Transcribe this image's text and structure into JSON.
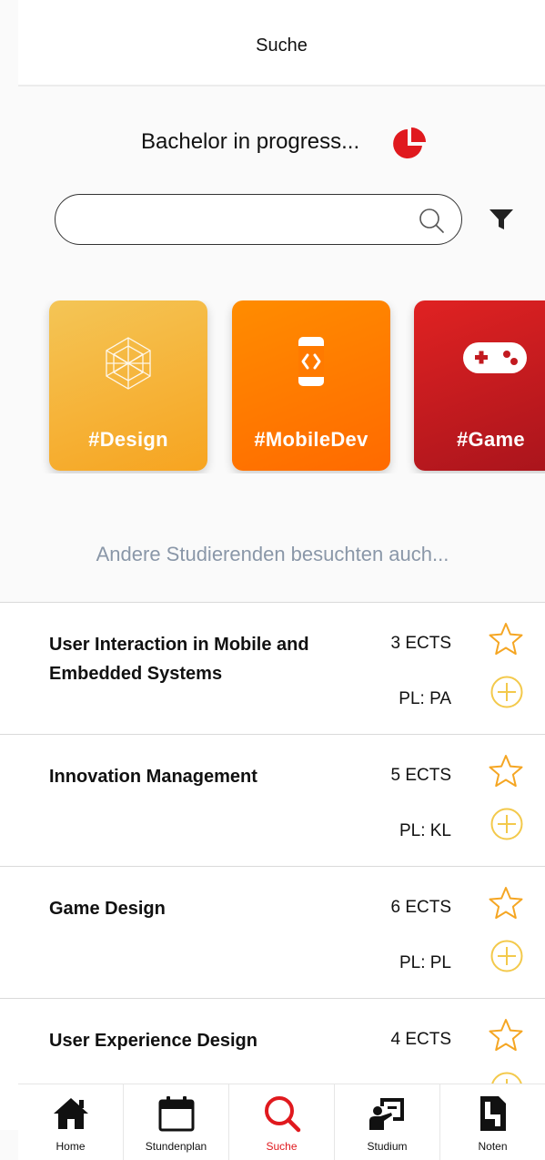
{
  "header": {
    "title": "Suche"
  },
  "progress": {
    "text": "Bachelor in progress...",
    "icon": "pie-chart-icon",
    "color": "#e0191e"
  },
  "search": {
    "placeholder": "",
    "value": ""
  },
  "tiles": [
    {
      "label": "#Design",
      "icon": "hexagon-icon"
    },
    {
      "label": "#MobileDev",
      "icon": "mobile-code-icon"
    },
    {
      "label": "#Game",
      "icon": "gamepad-icon"
    }
  ],
  "suggestions_title": "Andere Studierenden besuchten auch...",
  "courses": [
    {
      "name": "User Interaction in Mobile and Embedded Systems",
      "ects": "3 ECTS",
      "pl": "PL: PA"
    },
    {
      "name": "Innovation Management",
      "ects": "5 ECTS",
      "pl": "PL: KL"
    },
    {
      "name": "Game Design",
      "ects": "6 ECTS",
      "pl": "PL: PL"
    },
    {
      "name": "User Experience Design",
      "ects": "4 ECTS",
      "pl": ""
    }
  ],
  "nav": [
    {
      "label": "Home",
      "icon": "home-icon",
      "active": false
    },
    {
      "label": "Stundenplan",
      "icon": "calendar-icon",
      "active": false
    },
    {
      "label": "Suche",
      "icon": "search-icon",
      "active": true
    },
    {
      "label": "Studium",
      "icon": "presentation-icon",
      "active": false
    },
    {
      "label": "Noten",
      "icon": "document-icon",
      "active": false
    }
  ],
  "colors": {
    "accent": "#e0191e",
    "star": "#f5a623",
    "plus": "#f3c94b"
  }
}
